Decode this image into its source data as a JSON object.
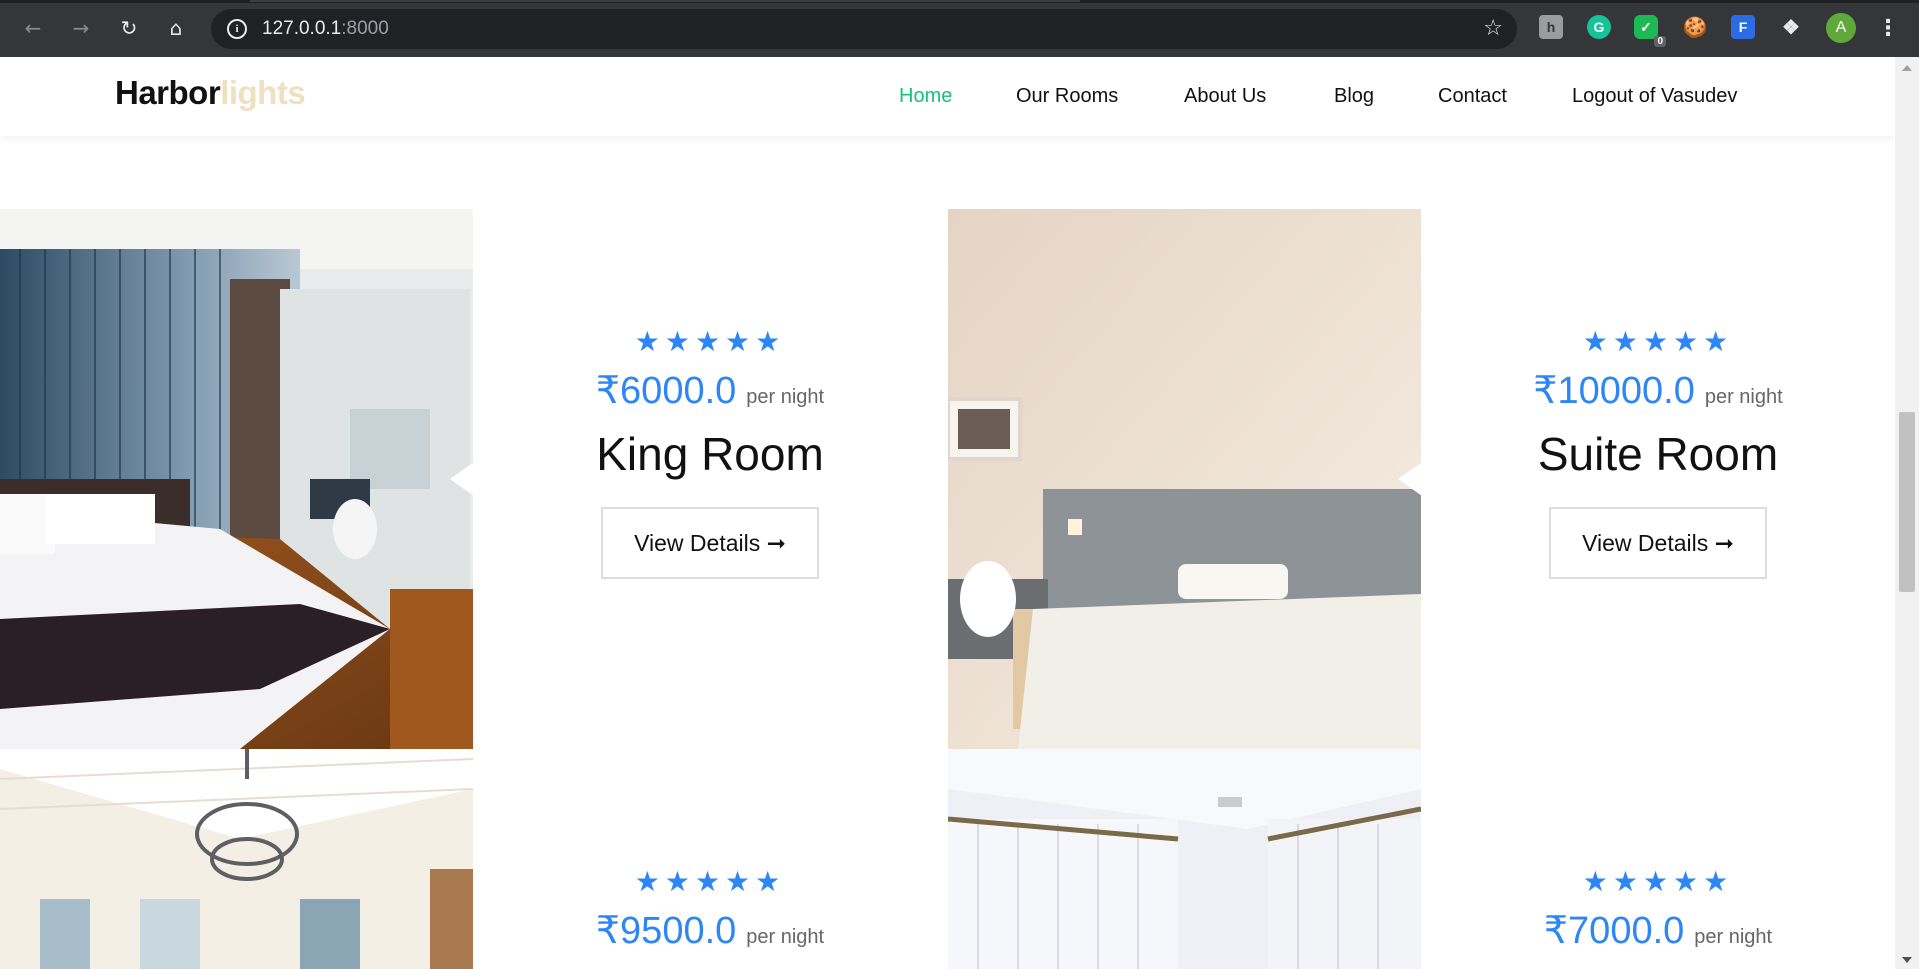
{
  "browser": {
    "url_host": "127.0.0.1",
    "url_port": ":8000",
    "check_badge": "0",
    "profile_initial": "A",
    "ext_h": "h",
    "ext_g": "G",
    "ext_f": "F"
  },
  "brand": {
    "part1": "Harbor",
    "part2": "lights",
    "accent_color": "#17c27b",
    "star_color": "#2e86f5"
  },
  "nav": {
    "home": "Home",
    "rooms": "Our Rooms",
    "about": "About Us",
    "blog": "Blog",
    "contact": "Contact",
    "logout": "Logout of Vasudev"
  },
  "rooms": [
    {
      "stars": "★★★★★",
      "rating": 5,
      "price": "₹6000.0",
      "per": "per night",
      "name": "King Room",
      "button": "View Details ➞"
    },
    {
      "stars": "★★★★★",
      "rating": 5,
      "price": "₹10000.0",
      "per": "per night",
      "name": "Suite Room",
      "button": "View Details ➞"
    },
    {
      "stars": "★★★★★",
      "rating": 5,
      "price": "₹9500.0",
      "per": "per night",
      "name": "",
      "button": ""
    },
    {
      "stars": "★★★★★",
      "rating": 5,
      "price": "₹7000.0",
      "per": "per night",
      "name": "",
      "button": ""
    }
  ]
}
